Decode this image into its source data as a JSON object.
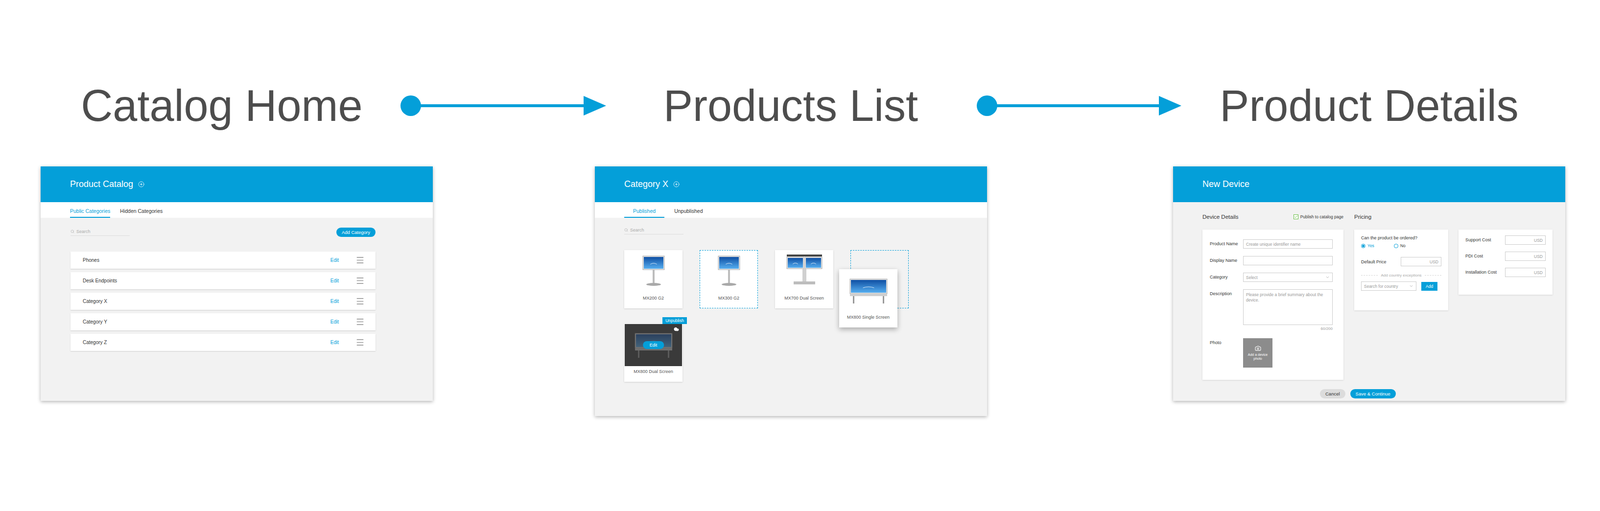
{
  "flow": {
    "steps": [
      {
        "title": "Catalog Home"
      },
      {
        "title": "Products List"
      },
      {
        "title": "Product Details"
      }
    ]
  },
  "catalog_home": {
    "header": {
      "title": "Product Catalog"
    },
    "tabs": [
      {
        "label": "Public Categories",
        "selected": true
      },
      {
        "label": "Hidden Categories",
        "selected": false
      }
    ],
    "search": {
      "placeholder": "Search"
    },
    "add_button": "Add Category",
    "categories": [
      {
        "name": "Phones",
        "action": "Edit"
      },
      {
        "name": "Desk Endpoints",
        "action": "Edit"
      },
      {
        "name": "Category X",
        "action": "Edit"
      },
      {
        "name": "Category Y",
        "action": "Edit"
      },
      {
        "name": "Category Z",
        "action": "Edit"
      }
    ]
  },
  "products_list": {
    "header": {
      "title": "Category X"
    },
    "tabs": [
      {
        "label": "Published",
        "selected": true
      },
      {
        "label": "Unpublished",
        "selected": false
      }
    ],
    "search": {
      "placeholder": "Search"
    },
    "products": [
      {
        "name": "MX200 G2",
        "state": "normal"
      },
      {
        "name": "MX300 G2",
        "state": "selected"
      },
      {
        "name": "MX700 Dual Screen",
        "state": "normal"
      },
      {
        "name": "MX800 Single Screen",
        "state": "dragging"
      },
      {
        "name": "MX800 Dual Screen",
        "state": "hover",
        "badge": "Unpublish",
        "action": "Edit"
      }
    ]
  },
  "product_details": {
    "header": {
      "title": "New Device"
    },
    "device_details": {
      "title": "Device Details",
      "publish": {
        "label": "Publish to catalog page",
        "checked": true
      },
      "fields": [
        {
          "label": "Product Name",
          "kind": "text",
          "placeholder": "Create unique identifier name"
        },
        {
          "label": "Display Name",
          "kind": "text",
          "placeholder": ""
        },
        {
          "label": "Category",
          "kind": "select",
          "placeholder": "Select"
        },
        {
          "label": "Description",
          "kind": "textarea",
          "placeholder": "Please provide a brief summary about the device.",
          "counter": "60/200"
        },
        {
          "label": "Photo",
          "kind": "photo",
          "placeholder": "Add a device photo"
        }
      ]
    },
    "pricing": {
      "title": "Pricing",
      "question": "Can the product be ordered?",
      "options": [
        {
          "label": "Yes",
          "selected": true
        },
        {
          "label": "No",
          "selected": false
        }
      ],
      "default_price": {
        "label": "Default Price",
        "unit": "USD"
      },
      "exceptions_label": "Add country exceptions",
      "country_search": {
        "placeholder": "Search for country"
      },
      "add_button": "Add",
      "costs": [
        {
          "label": "Support Cost",
          "unit": "USD"
        },
        {
          "label": "PDI Cost",
          "unit": "USD"
        },
        {
          "label": "Installation Cost",
          "unit": "USD"
        }
      ]
    },
    "buttons": [
      {
        "label": "Cancel",
        "kind": "secondary"
      },
      {
        "label": "Save & Continue",
        "kind": "primary"
      }
    ]
  }
}
